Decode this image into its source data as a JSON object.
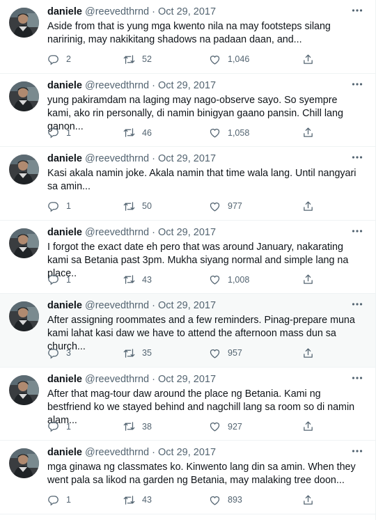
{
  "tweets": [
    {
      "name": "daniele",
      "handle": "@reevedthrnd",
      "date": "Oct 29, 2017",
      "text": "Aside from that is yung mga kwento nila na may footsteps silang naririnig, may nakikitang shadows na padaan daan, and...",
      "replies": "2",
      "retweets": "52",
      "likes": "1,046",
      "highlighted": false
    },
    {
      "name": "daniele",
      "handle": "@reevedthrnd",
      "date": "Oct 29, 2017",
      "text": "yung pakiramdam na laging may nago-observe sayo. So syempre kami, ako rin personally, di namin binigyan gaano pansin. Chill lang ganon...",
      "replies": "1",
      "retweets": "46",
      "likes": "1,058",
      "highlighted": false
    },
    {
      "name": "daniele",
      "handle": "@reevedthrnd",
      "date": "Oct 29, 2017",
      "text": "Kasi akala namin joke. Akala namin that time wala lang. Until nangyari sa amin...",
      "replies": "1",
      "retweets": "50",
      "likes": "977",
      "highlighted": false
    },
    {
      "name": "daniele",
      "handle": "@reevedthrnd",
      "date": "Oct 29, 2017",
      "text": "I forgot the exact date eh pero that was around January, nakarating kami sa Betania past 3pm. Mukha siyang normal and simple lang na place..",
      "replies": "1",
      "retweets": "43",
      "likes": "1,008",
      "highlighted": false
    },
    {
      "name": "daniele",
      "handle": "@reevedthrnd",
      "date": "Oct 29, 2017",
      "text": "After assigning roommates and a few reminders. Pinag-prepare muna kami lahat kasi daw we have to attend the afternoon mass dun sa church...",
      "replies": "3",
      "retweets": "35",
      "likes": "957",
      "highlighted": true
    },
    {
      "name": "daniele",
      "handle": "@reevedthrnd",
      "date": "Oct 29, 2017",
      "text": "After that mag-tour daw around the place ng Betania. Kami ng bestfriend ko we stayed behind and nagchill lang sa room so di namin alam...",
      "replies": "1",
      "retweets": "38",
      "likes": "927",
      "highlighted": false
    },
    {
      "name": "daniele",
      "handle": "@reevedthrnd",
      "date": "Oct 29, 2017",
      "text": "mga ginawa ng classmates ko. Kinwento lang din sa amin. When they went pala sa likod na garden ng Betania, may malaking tree doon...",
      "replies": "1",
      "retweets": "43",
      "likes": "893",
      "highlighted": false
    }
  ],
  "separator": "·",
  "icons": {
    "reply": "reply-icon",
    "retweet": "retweet-icon",
    "like": "heart-icon",
    "share": "share-icon",
    "more": "more-icon"
  },
  "colors": {
    "text": "#0f1419",
    "secondary": "#536471",
    "divider": "#eff3f4",
    "highlight_bg": "#f7f9f9"
  }
}
